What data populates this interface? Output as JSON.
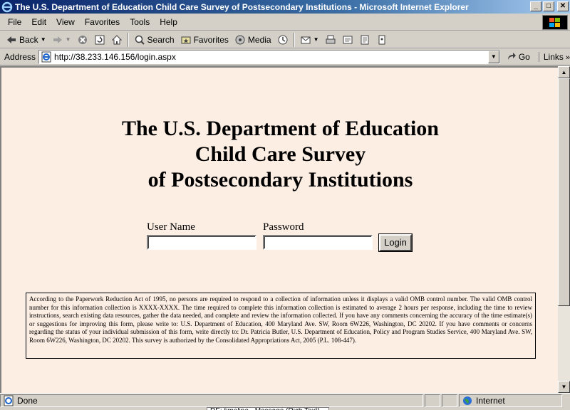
{
  "window": {
    "title": "The U.S. Department of Education Child Care Survey of Postsecondary Institutions - Microsoft Internet Explorer",
    "buttons": [
      "_",
      "□",
      "✕"
    ]
  },
  "menu": [
    "File",
    "Edit",
    "View",
    "Favorites",
    "Tools",
    "Help"
  ],
  "toolbar": {
    "back_label": "Back",
    "search_label": "Search",
    "favorites_label": "Favorites",
    "media_label": "Media"
  },
  "address": {
    "label": "Address",
    "url": "http://38.233.146.156/login.aspx",
    "go_label": "Go",
    "links_label": "Links"
  },
  "page": {
    "heading_line1": "The U.S. Department of Education",
    "heading_line2": "Child Care Survey",
    "heading_line3": "of Postsecondary Institutions",
    "username_label": "User Name",
    "username_value": "",
    "password_label": "Password",
    "password_value": "",
    "login_label": "Login",
    "notice": "According to the Paperwork Reduction Act of 1995, no persons are required to respond to a collection of information unless it displays a valid OMB control number. The valid OMB control number for this information collection is XXXX-XXXX. The time required to complete this information collection is estimated to average 2 hours per response, including the time to review instructions, search existing data resources, gather the data needed, and complete and review the information collected. If you have any comments concerning the accuracy of the time estimate(s) or suggestions for improving this form, please write to: U.S. Department of Education, 400 Maryland Ave. SW, Room 6W226, Washington, DC 20202. If you have comments or concerns regarding the status of your individual submission of this form, write directly to: Dr. Patricia Butler, U.S. Department of Education, Policy and Program Studies Service, 400 Maryland Ave. SW, Room 6W226, Washington, DC 20202. This survey is authorized by the Consolidated Appropriations Act, 2005 (P.L. 108-447)."
  },
  "status": {
    "text": "Done",
    "zone": "Internet"
  },
  "taskbar": {
    "peek_text": "RE: timeline - Message (Rich Text)"
  }
}
